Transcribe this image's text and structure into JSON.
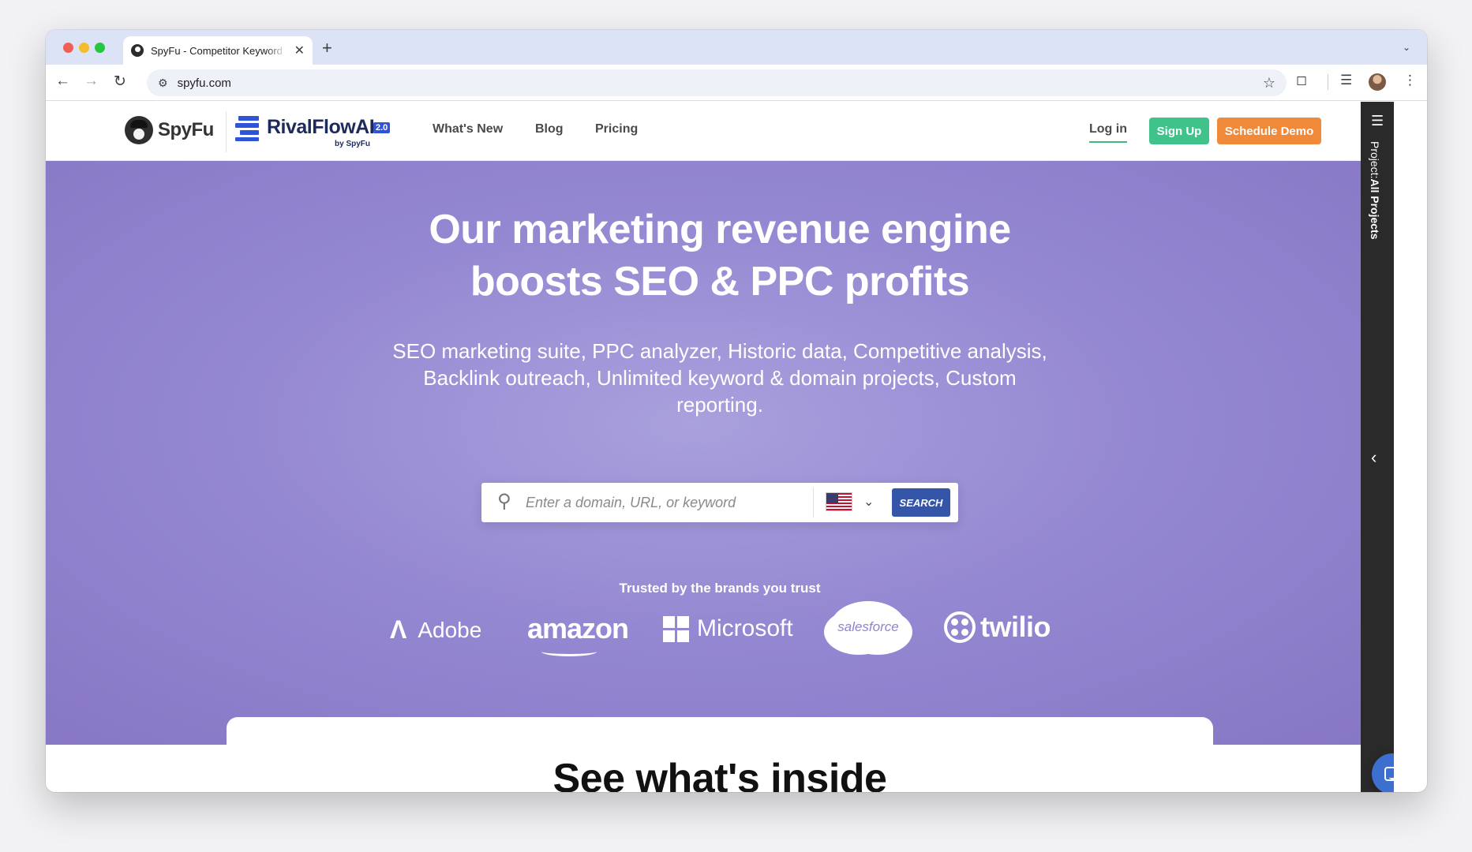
{
  "browser": {
    "tab_title": "SpyFu - Competitor Keyword Research Tools",
    "url": "spyfu.com",
    "new_tab_glyph": "+",
    "close_glyph": "✕"
  },
  "site": {
    "spyfu_logo_text": "SpyFu",
    "rivalflow_logo_text": "RivalFlowAI",
    "rivalflow_badge": "2.0",
    "rivalflow_by": "by SpyFu",
    "nav": {
      "whats_new": "What's New",
      "blog": "Blog",
      "pricing": "Pricing"
    },
    "login": "Log in",
    "signup": "Sign Up",
    "demo": "Schedule Demo"
  },
  "hero": {
    "title_line1": "Our marketing revenue engine",
    "title_line2": "boosts SEO & PPC profits",
    "subtitle": "SEO marketing suite, PPC analyzer, Historic data, Competitive analysis, Backlink outreach, Unlimited keyword & domain projects, Custom reporting.",
    "search_placeholder": "Enter a domain, URL, or keyword",
    "search_button": "SEARCH",
    "country": "United States",
    "trusted_heading": "Trusted by the brands you trust",
    "brands": {
      "adobe": "Adobe",
      "amazon": "amazon",
      "microsoft": "Microsoft",
      "salesforce": "salesforce",
      "twilio": "twilio"
    }
  },
  "section": {
    "inside_title": "See what's inside"
  },
  "side_panel": {
    "label_prefix": "Project:",
    "label_value": "All Projects"
  },
  "colors": {
    "hero_purple": "#9588d2",
    "signup_green": "#3fc38a",
    "demo_orange": "#f08a3a",
    "search_blue": "#3555a8",
    "rivalflow_blue": "#2f54d6"
  }
}
